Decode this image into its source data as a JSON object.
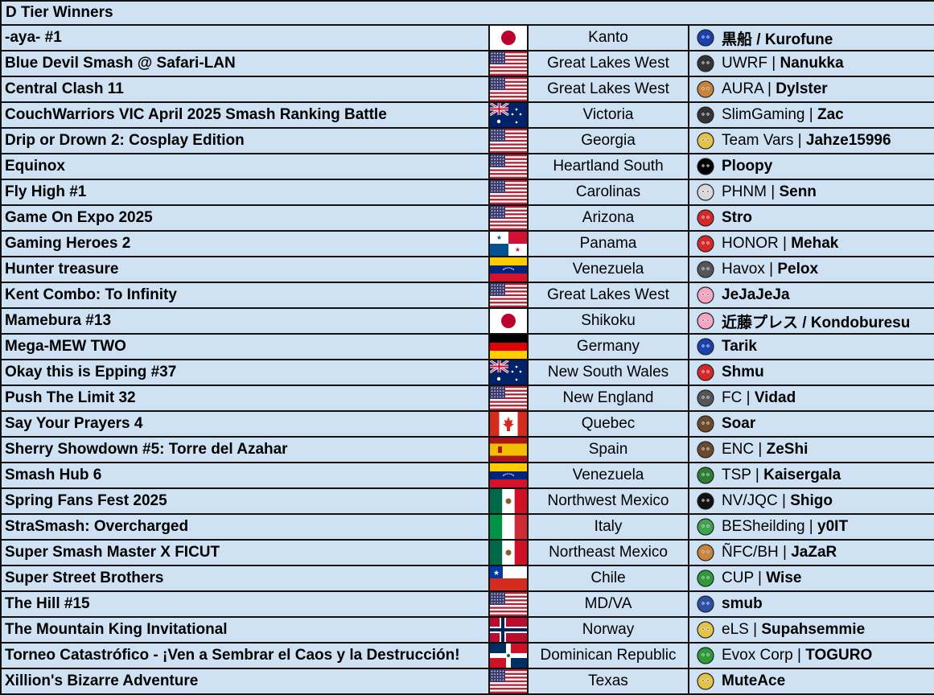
{
  "table": {
    "title": "D Tier Winners",
    "rows": [
      {
        "name": "-aya- #1",
        "flag": "jp",
        "region": "Kanto",
        "team": "",
        "player": "黒船 / Kurofune",
        "icon": "sonic-icon",
        "icon_color": "#1c3fb3"
      },
      {
        "name": "Blue Devil Smash @ Safari-LAN",
        "flag": "us",
        "region": "Great Lakes West",
        "team": "UWRF",
        "player": "Nanukka",
        "icon": "kazuya-icon",
        "icon_color": "#333333"
      },
      {
        "name": "Central Clash 11",
        "flag": "us",
        "region": "Great Lakes West",
        "team": "AURA",
        "player": "Dylster",
        "icon": "diddy-icon",
        "icon_color": "#c8843a"
      },
      {
        "name": "CouchWarriors VIC April 2025 Smash Ranking Battle",
        "flag": "au",
        "region": "Victoria",
        "team": "SlimGaming",
        "player": "Zac",
        "icon": "kazuya-icon",
        "icon_color": "#333333"
      },
      {
        "name": "Drip or Drown 2: Cosplay Edition",
        "flag": "us",
        "region": "Georgia",
        "team": "Team Vars",
        "player": "Jahze15996",
        "icon": "zelda-icon",
        "icon_color": "#e5c24a"
      },
      {
        "name": "Equinox",
        "flag": "us",
        "region": "Heartland South",
        "team": "",
        "player": "Ploopy",
        "icon": "gnw-icon",
        "icon_color": "#000000"
      },
      {
        "name": "Fly High #1",
        "flag": "us",
        "region": "Carolinas",
        "team": "PHNM",
        "player": "Senn",
        "icon": "sheik-icon",
        "icon_color": "#d9d9d9"
      },
      {
        "name": "Game On Expo 2025",
        "flag": "us",
        "region": "Arizona",
        "team": "",
        "player": "Stro",
        "icon": "mario-icon",
        "icon_color": "#d62828"
      },
      {
        "name": "Gaming Heroes 2",
        "flag": "pa",
        "region": "Panama",
        "team": "HONOR",
        "player": "Mehak",
        "icon": "trainer-icon",
        "icon_color": "#d62828"
      },
      {
        "name": "Hunter treasure",
        "flag": "ve",
        "region": "Venezuela",
        "team": "Havox",
        "player": "Pelox",
        "icon": "rob-icon",
        "icon_color": "#555555"
      },
      {
        "name": "Kent Combo: To Infinity",
        "flag": "us",
        "region": "Great Lakes West",
        "team": "",
        "player": "JeJaJeJa",
        "icon": "kirby-icon",
        "icon_color": "#f4a6c1"
      },
      {
        "name": "Mamebura #13",
        "flag": "jp",
        "region": "Shikoku",
        "team": "",
        "player": "近藤プレス / Kondoburesu",
        "icon": "kirby-icon",
        "icon_color": "#f4a6c1"
      },
      {
        "name": "Mega-MEW TWO",
        "flag": "de",
        "region": "Germany",
        "team": "",
        "player": "Tarik",
        "icon": "falcon-icon",
        "icon_color": "#1c3fb3"
      },
      {
        "name": "Okay this is Epping #37",
        "flag": "au",
        "region": "New South Wales",
        "team": "",
        "player": "Shmu",
        "icon": "pokeball-icon",
        "icon_color": "#d62828"
      },
      {
        "name": "Push The Limit 32",
        "flag": "us",
        "region": "New England",
        "team": "FC",
        "player": "Vidad",
        "icon": "rob-icon",
        "icon_color": "#555555"
      },
      {
        "name": "Say Your Prayers 4",
        "flag": "ca",
        "region": "Quebec",
        "team": "",
        "player": "Soar",
        "icon": "steve-icon",
        "icon_color": "#6b4a2b"
      },
      {
        "name": "Sherry Showdown #5: Torre del Azahar",
        "flag": "es",
        "region": "Spain",
        "team": "ENC",
        "player": "ZeShi",
        "icon": "steve-icon",
        "icon_color": "#6b4a2b"
      },
      {
        "name": "Smash Hub 6",
        "flag": "ve",
        "region": "Venezuela",
        "team": "TSP",
        "player": "Kaisergala",
        "icon": "terry-icon",
        "icon_color": "#2e7d32"
      },
      {
        "name": "Spring Fans Fest 2025",
        "flag": "mx",
        "region": "Northwest Mexico",
        "team": "NV/JQC",
        "player": "Shigo",
        "icon": "joker-icon",
        "icon_color": "#111111"
      },
      {
        "name": "StraSmash: Overcharged",
        "flag": "it",
        "region": "Italy",
        "team": "BESheilding",
        "player": "y0IT",
        "icon": "yoshi-icon",
        "icon_color": "#3fa34d"
      },
      {
        "name": "Super Smash Master X FICUT",
        "flag": "mx",
        "region": "Northeast Mexico",
        "team": "ÑFC/BH",
        "player": "JaZaR",
        "icon": "luigi-icon",
        "icon_color": "#c8843a"
      },
      {
        "name": "Super Street Brothers",
        "flag": "cl",
        "region": "Chile",
        "team": "CUP",
        "player": "Wise",
        "icon": "luigi-icon",
        "icon_color": "#2e9a3a"
      },
      {
        "name": "The Hill #15",
        "flag": "us",
        "region": "MD/VA",
        "team": "",
        "player": "smub",
        "icon": "falco-icon",
        "icon_color": "#2c4fa8"
      },
      {
        "name": "The Mountain King Invitational",
        "flag": "no",
        "region": "Norway",
        "team": "eLS",
        "player": "Supahsemmie",
        "icon": "link-icon",
        "icon_color": "#e5c24a"
      },
      {
        "name": "Torneo Catastrófico - ¡Ven a Sembrar el Caos y la Destrucción!",
        "flag": "do",
        "region": "Dominican Republic",
        "team": "Evox Corp",
        "player": "TOGURO",
        "icon": "luigi-icon",
        "icon_color": "#2e9a3a"
      },
      {
        "name": "Xillion's Bizarre Adventure",
        "flag": "us",
        "region": "Texas",
        "team": "",
        "player": "MuteAce",
        "icon": "peach-icon",
        "icon_color": "#e5c24a"
      }
    ]
  }
}
